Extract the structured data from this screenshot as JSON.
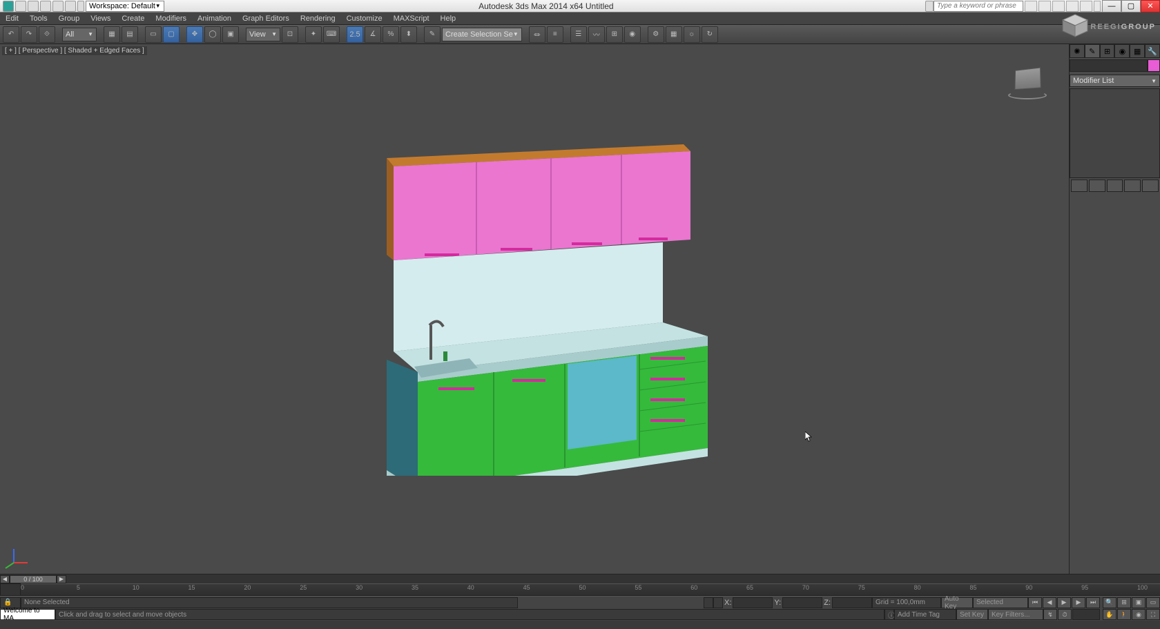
{
  "titlebar": {
    "workspace_label": "Workspace: Default",
    "app_title": "Autodesk 3ds Max  2014 x64      Untitled",
    "search_placeholder": "Type a keyword or phrase",
    "min": "—",
    "max": "▢",
    "close": "✕"
  },
  "menus": [
    "Edit",
    "Tools",
    "Group",
    "Views",
    "Create",
    "Modifiers",
    "Animation",
    "Graph Editors",
    "Rendering",
    "Customize",
    "MAXScript",
    "Help"
  ],
  "toolbar": {
    "filter": "All",
    "rcs_label": "View",
    "create_sel_label": "Create Selection Se",
    "snap_label": "2.5"
  },
  "viewport": {
    "label": "[ + ] [ Perspective ] [ Shaded + Edged Faces ]"
  },
  "cmdpanel": {
    "modifier_list": "Modifier List"
  },
  "logo": {
    "text_a": "REEGI",
    "text_b": "GROUP"
  },
  "timeline": {
    "frame_text": "0 / 100",
    "ticks": [
      "0",
      "5",
      "10",
      "15",
      "20",
      "25",
      "30",
      "35",
      "40",
      "45",
      "50",
      "55",
      "60",
      "65",
      "70",
      "75",
      "80",
      "85",
      "90",
      "95",
      "100"
    ]
  },
  "status": {
    "selection": "None Selected",
    "x": "X:",
    "y": "Y:",
    "z": "Z:",
    "grid": "Grid = 100,0mm",
    "autokey": "Auto Key",
    "setkey": "Set Key",
    "selected": "Selected",
    "keyfilters": "Key Filters...",
    "addtimetag": "Add Time Tag",
    "prompt": "Welcome to MA",
    "hint": "Click and drag to select and move objects"
  }
}
